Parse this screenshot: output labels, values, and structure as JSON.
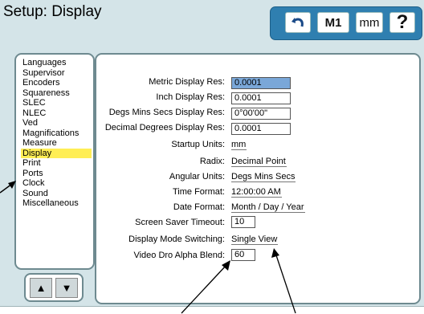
{
  "header": {
    "title": "Setup: Display"
  },
  "toolbar": {
    "m1_label": "M1",
    "mm_label": "mm",
    "help_label": "?"
  },
  "sidebar": {
    "items": [
      {
        "label": "Languages"
      },
      {
        "label": "Supervisor"
      },
      {
        "label": "Encoders"
      },
      {
        "label": "Squareness"
      },
      {
        "label": "SLEC"
      },
      {
        "label": "NLEC"
      },
      {
        "label": "Ved"
      },
      {
        "label": "Magnifications"
      },
      {
        "label": "Measure"
      },
      {
        "label": "Display"
      },
      {
        "label": "Print"
      },
      {
        "label": "Ports"
      },
      {
        "label": "Clock"
      },
      {
        "label": "Sound"
      },
      {
        "label": "Miscellaneous"
      }
    ],
    "selected": "Display"
  },
  "settings": {
    "metric_res": {
      "label": "Metric Display Res:",
      "value": "0.0001"
    },
    "inch_res": {
      "label": "Inch Display Res:",
      "value": "0.0001"
    },
    "dms_res": {
      "label": "Degs Mins Secs Display Res:",
      "value": "0°00'00\""
    },
    "decdeg_res": {
      "label": "Decimal Degrees Display Res:",
      "value": "0.0001"
    },
    "startup_units": {
      "label": "Startup Units:",
      "value": "mm"
    },
    "radix": {
      "label": "Radix:",
      "value": "Decimal Point"
    },
    "angular_units": {
      "label": "Angular Units:",
      "value": "Degs Mins Secs"
    },
    "time_format": {
      "label": "Time Format:",
      "value": "12:00:00 AM"
    },
    "date_format": {
      "label": "Date Format:",
      "value": "Month / Day / Year"
    },
    "screen_saver": {
      "label": "Screen Saver Timeout:",
      "value": "10"
    },
    "display_mode": {
      "label": "Display Mode Switching:",
      "value": "Single View"
    },
    "video_alpha": {
      "label": "Video Dro Alpha Blend:",
      "value": "60"
    }
  },
  "colors": {
    "screen_bg": "#d4e4e8",
    "toolbar_bg": "#2f7fb0",
    "selected_item": "#ffee55",
    "selected_field": "#7aa7d8"
  }
}
